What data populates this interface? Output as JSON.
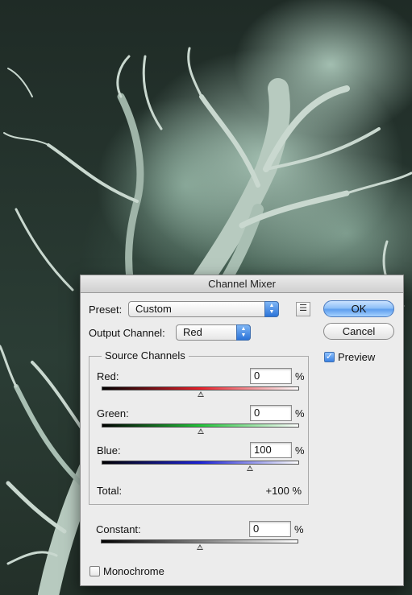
{
  "dialog": {
    "title": "Channel Mixer",
    "preset_label": "Preset:",
    "preset_value": "Custom",
    "output_label": "Output Channel:",
    "output_value": "Red",
    "ok_label": "OK",
    "cancel_label": "Cancel",
    "preview_label": "Preview",
    "preview_checked": true,
    "source_channels": {
      "title": "Source Channels",
      "channels": [
        {
          "label": "Red:",
          "value": "0",
          "unit": "%",
          "slider_percent": 0,
          "gradient": [
            "#000000",
            "#e8202a",
            "#ffffff"
          ]
        },
        {
          "label": "Green:",
          "value": "0",
          "unit": "%",
          "slider_percent": 0,
          "gradient": [
            "#000000",
            "#22c43a",
            "#ffffff"
          ]
        },
        {
          "label": "Blue:",
          "value": "100",
          "unit": "%",
          "slider_percent": 100,
          "gradient": [
            "#000000",
            "#1c22d8",
            "#ffffff"
          ]
        }
      ],
      "total_label": "Total:",
      "total_value": "+100 %"
    },
    "constant": {
      "label": "Constant:",
      "value": "0",
      "unit": "%",
      "slider_percent": 0
    },
    "monochrome_label": "Monochrome",
    "monochrome_checked": false
  }
}
